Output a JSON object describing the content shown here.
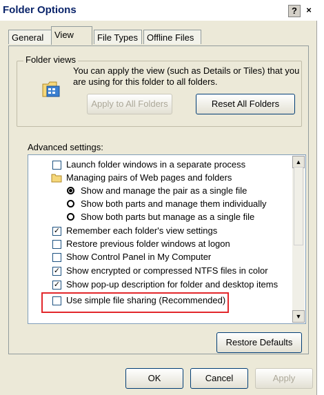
{
  "window": {
    "title": "Folder Options",
    "help_label": "?",
    "close_label": "×"
  },
  "tabs": [
    {
      "label": "General"
    },
    {
      "label": "View"
    },
    {
      "label": "File Types"
    },
    {
      "label": "Offline Files"
    }
  ],
  "folder_views": {
    "label": "Folder views",
    "description": "You can apply the view (such as Details or Tiles) that you are using for this folder to all folders.",
    "apply_all_label": "Apply to All Folders",
    "reset_all_label": "Reset All Folders"
  },
  "advanced": {
    "label": "Advanced settings:",
    "items": [
      {
        "type": "checkbox",
        "checked": false,
        "label": "Launch folder windows in a separate process"
      },
      {
        "type": "folder",
        "label": "Managing pairs of Web pages and folders"
      },
      {
        "type": "radio",
        "checked": true,
        "label": "Show and manage the pair as a single file"
      },
      {
        "type": "radio",
        "checked": false,
        "label": "Show both parts and manage them individually"
      },
      {
        "type": "radio",
        "checked": false,
        "label": "Show both parts but manage as a single file"
      },
      {
        "type": "checkbox",
        "checked": true,
        "label": "Remember each folder's view settings"
      },
      {
        "type": "checkbox",
        "checked": false,
        "label": "Restore previous folder windows at logon"
      },
      {
        "type": "checkbox",
        "checked": false,
        "label": "Show Control Panel in My Computer"
      },
      {
        "type": "checkbox",
        "checked": true,
        "label": "Show encrypted or compressed NTFS files in color"
      },
      {
        "type": "checkbox",
        "checked": true,
        "label": "Show pop-up description for folder and desktop items"
      },
      {
        "type": "checkbox",
        "checked": false,
        "label": "Use simple file sharing (Recommended)"
      }
    ],
    "restore_defaults_label": "Restore Defaults"
  },
  "footer": {
    "ok_label": "OK",
    "cancel_label": "Cancel",
    "apply_label": "Apply"
  },
  "colors": {
    "highlight": "#e2262a",
    "title_text": "#0a246a"
  }
}
